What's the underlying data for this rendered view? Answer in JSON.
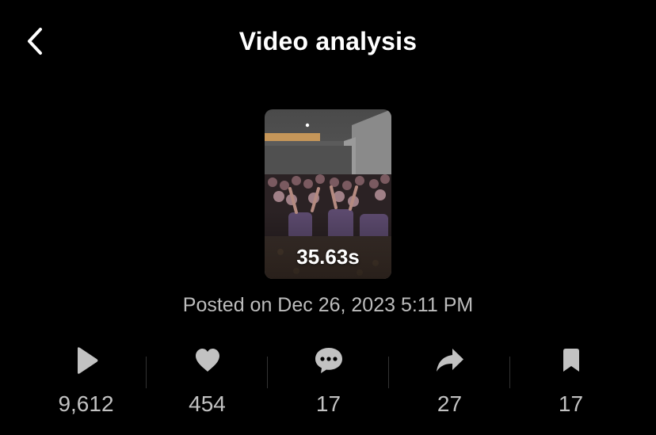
{
  "header": {
    "title": "Video analysis",
    "back_icon": "chevron-left-icon"
  },
  "video": {
    "duration": "35.63s",
    "posted": "Posted on Dec 26, 2023 5:11 PM"
  },
  "stats": [
    {
      "icon": "play-icon",
      "value": "9,612"
    },
    {
      "icon": "heart-icon",
      "value": "454"
    },
    {
      "icon": "comment-icon",
      "value": "17"
    },
    {
      "icon": "share-icon",
      "value": "27"
    },
    {
      "icon": "bookmark-icon",
      "value": "17"
    }
  ],
  "colors": {
    "background": "#000000",
    "text": "#ffffff",
    "secondary_text": "#bdbdbd",
    "icon": "#c2c2c2"
  }
}
